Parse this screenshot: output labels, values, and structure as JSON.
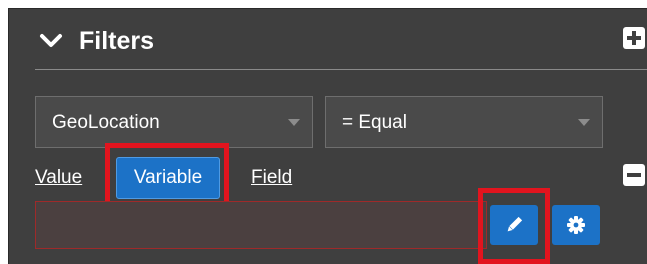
{
  "filters": {
    "title": "Filters",
    "field_select": {
      "value": "GeoLocation"
    },
    "operator_select": {
      "value": "= Equal"
    },
    "mode_tabs": {
      "value_label": "Value",
      "variable_label": "Variable",
      "field_label": "Field",
      "active": "Variable"
    },
    "value_input": {
      "value": ""
    },
    "icons": {
      "collapse": "chevron-down-icon",
      "add": "plus-icon",
      "remove": "minus-icon",
      "edit": "pencil-icon",
      "settings": "gear-icon"
    }
  },
  "colors": {
    "panel_bg": "#3f3f3f",
    "accent_blue": "#1c72c7",
    "highlight_red": "#e2141e",
    "error_border": "#9e2a2a"
  }
}
